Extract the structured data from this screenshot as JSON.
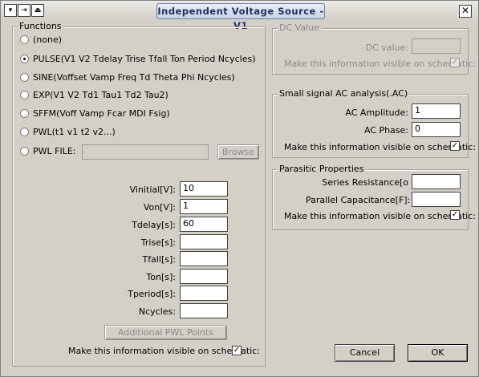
{
  "window": {
    "title": "Independent Voltage Source - V1",
    "close_glyph": "✕"
  },
  "functions": {
    "legend": "Functions",
    "options": [
      {
        "label": "(none)",
        "selected": false
      },
      {
        "label": "PULSE(V1 V2 Tdelay Trise Tfall Ton Period Ncycles)",
        "selected": true
      },
      {
        "label": "SINE(Voffset Vamp Freq Td Theta Phi Ncycles)",
        "selected": false
      },
      {
        "label": "EXP(V1 V2 Td1 Tau1 Td2 Tau2)",
        "selected": false
      },
      {
        "label": "SFFM(Voff Vamp Fcar MDI Fsig)",
        "selected": false
      },
      {
        "label": "PWL(t1 v1 t2 v2...)",
        "selected": false
      },
      {
        "label": "PWL FILE:",
        "selected": false
      }
    ],
    "pwl_file_value": "",
    "browse_label": "Browse",
    "params": [
      {
        "label": "Vinitial[V]:",
        "value": "10"
      },
      {
        "label": "Von[V]:",
        "value": "1"
      },
      {
        "label": "Tdelay[s]:",
        "value": "60"
      },
      {
        "label": "Trise[s]:",
        "value": ""
      },
      {
        "label": "Tfall[s]:",
        "value": ""
      },
      {
        "label": "Ton[s]:",
        "value": ""
      },
      {
        "label": "Tperiod[s]:",
        "value": ""
      },
      {
        "label": "Ncycles:",
        "value": ""
      }
    ],
    "additional_pwl_label": "Additional PWL Points",
    "visible_label": "Make this information visible on schematic:",
    "visible_checked": true
  },
  "dc": {
    "legend": "DC Value",
    "value_label": "DC value:",
    "value": "",
    "visible_label": "Make this information visible on schematic:",
    "visible_checked": true
  },
  "ac": {
    "legend": "Small signal AC analysis(.AC)",
    "amplitude_label": "AC Amplitude:",
    "amplitude": "1",
    "phase_label": "AC Phase:",
    "phase": "0",
    "visible_label": "Make this information visible on schematic:",
    "visible_checked": true
  },
  "parasitic": {
    "legend": "Parasitic Properties",
    "rs_label": "Series Resistance[o",
    "rs": "",
    "cp_label": "Parallel Capacitance[F]:",
    "cp": "",
    "visible_label": "Make this information visible on schematic:",
    "visible_checked": true
  },
  "buttons": {
    "cancel": "Cancel",
    "ok": "OK"
  },
  "check_glyph": "✓"
}
